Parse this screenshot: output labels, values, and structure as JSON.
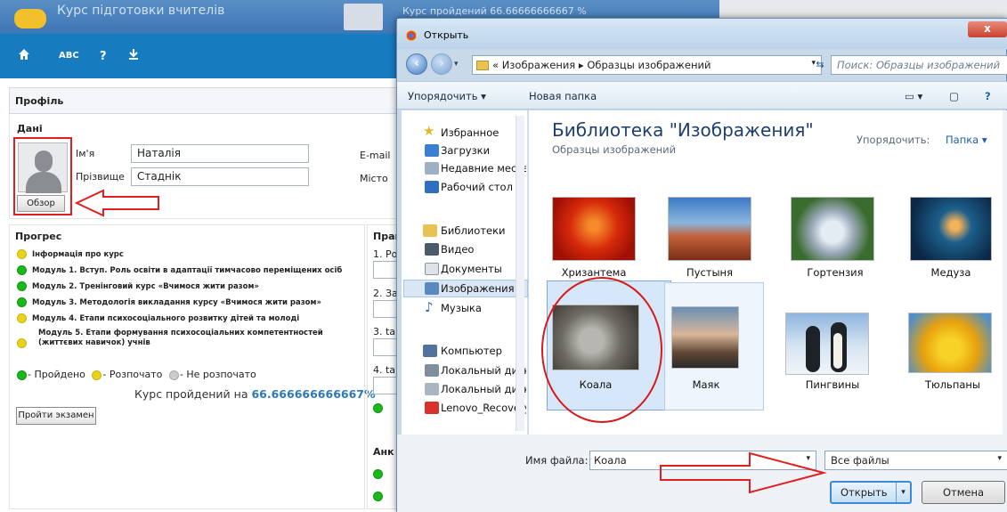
{
  "app": {
    "title": "Курс підготовки вчителів",
    "course_progress_top": "Курс пройдений 66.66666666667 %",
    "nav": {
      "home_icon": "home-icon",
      "abc": "ABC",
      "help": "?",
      "download_icon": "download-icon"
    }
  },
  "profile": {
    "heading": "Профіль",
    "section": "Дані",
    "first_name_label": "Ім'я",
    "first_name": "Наталія",
    "last_name_label": "Прізвище",
    "last_name": "Стаднік",
    "email_label": "E-mail",
    "city_label": "Місто",
    "browse_button": "Обзор"
  },
  "progress": {
    "heading": "Прогрес",
    "items": [
      {
        "status": "yellow",
        "text": "Інформація про курс"
      },
      {
        "status": "green",
        "text": "Модуль 1. Вступ. Роль освіти в адаптації тимчасово переміщених осіб"
      },
      {
        "status": "green",
        "text": "Модуль 2. Тренінговий курс «Вчимося жити разом»"
      },
      {
        "status": "green",
        "text": "Модуль 3. Методологія викладання курсу «Вчимося жити разом»"
      },
      {
        "status": "yellow",
        "text": "Модуль 4. Етапи психосоціального розвитку дітей та молоді"
      },
      {
        "status": "yellow",
        "text": "Модуль 5. Етапи формування психосоціальних компетентностей (життєвих навичок) учнів"
      }
    ],
    "legend": {
      "passed": "- Пройдено",
      "started": "- Розпочато",
      "not_started": "- Не розпочато"
    },
    "summary_prefix": "Курс пройдений на ",
    "summary_value": "66.666666666667%",
    "exam_button": "Пройти экзамен",
    "right_heading": "Прап",
    "right_items": [
      "1. Ро",
      "2. За",
      "3. ta",
      "4. ta"
    ],
    "survey_heading": "Анк"
  },
  "dialog": {
    "title": "Открыть",
    "close": "x",
    "breadcrumb": "« Изображения ▸ Образцы изображений",
    "search_placeholder": "Поиск: Образцы изображений",
    "toolbar": {
      "organize": "Упорядочить ▾",
      "new_folder": "Новая папка"
    },
    "nav": {
      "favorites": "Избранное",
      "fav_items": [
        "Загрузки",
        "Недавние места",
        "Рабочий стол"
      ],
      "libraries": "Библиотеки",
      "lib_items": [
        "Видео",
        "Документы",
        "Изображения",
        "Музыка"
      ],
      "computer": "Компьютер",
      "comp_items": [
        "Локальный диск",
        "Локальный диск",
        "Lenovo_Recovery"
      ]
    },
    "library_title": "Библиотека \"Изображения\"",
    "library_subtitle": "Образцы изображений",
    "arrange_label": "Упорядочить:",
    "arrange_value": "Папка ▾",
    "files": [
      "Хризантема",
      "Пустыня",
      "Гортензия",
      "Медуза",
      "Коала",
      "Маяк",
      "Пингвины",
      "Тюльпаны"
    ],
    "filename_label": "Имя файла:",
    "filename_value": "Коала",
    "filetype": "Все файлы",
    "open_button": "Открыть",
    "cancel_button": "Отмена"
  },
  "colors": {
    "accent": "#167bbf",
    "annotation_red": "#e02020",
    "selection": "#d5e7f8"
  }
}
